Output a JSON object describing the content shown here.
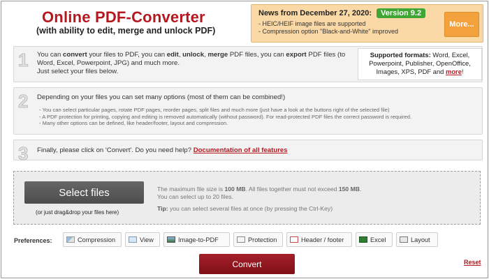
{
  "header": {
    "title": "Online PDF-Converter",
    "subtitle": "(with ability to edit, merge and unlock PDF)"
  },
  "news": {
    "title": "News from December 27, 2020:",
    "version": "Version 9.2",
    "items": [
      "HEIC/HEIF image files are supported",
      "Compression option \"Black-and-White\" improved"
    ],
    "more_label": "More..."
  },
  "step1": {
    "number": "1",
    "text_parts": {
      "a": "You can ",
      "b": "convert",
      "c": " your files to PDF, you can ",
      "d": "edit",
      "e": ", ",
      "f": "unlock",
      "g": ", ",
      "h": "merge",
      "i": " PDF files, you can ",
      "j": "export",
      "k": " PDF files (to Word, Excel, Powerpoint, JPG) and much more.",
      "l": "Just select your files below."
    },
    "formats_label": "Supported formats:",
    "formats_text": " Word, Excel, Powerpoint, Publisher, OpenOffice, Images, XPS, PDF and ",
    "formats_more": "more",
    "formats_end": "!"
  },
  "step2": {
    "number": "2",
    "text": "Depending on your files you can set many options (most of them can be combined!)",
    "items": [
      "You can select particular pages, rotate PDF pages, reorder pages, split files and much more (just have a look at the buttons right of the selected file)",
      "A PDF protection for printing, copying and editing is removed automatically (without password). For read-protected PDF files the correct password is required.",
      "Many other options can be defined, like header/footer, layout and compression."
    ]
  },
  "step3": {
    "number": "3",
    "text": "Finally, please click on 'Convert'. Do you need help? ",
    "link": "Documentation of all features"
  },
  "upload": {
    "select_label": "Select files",
    "drag_hint": "(or just drag&drop your files here)",
    "info_a": "The maximum file size is ",
    "info_size": "100 MB",
    "info_b": ". All files together must not exceed ",
    "info_total": "150 MB",
    "info_c": ".",
    "info_line2": "You can select up to 20 files.",
    "tip_label": "Tip:",
    "tip_text": " you can select several files at once (by pressing the Ctrl-Key)"
  },
  "preferences": {
    "label": "Preferences:",
    "items": [
      {
        "label": "Compression",
        "icon": "compression-icon"
      },
      {
        "label": "View",
        "icon": "view-icon"
      },
      {
        "label": "Image-to-PDF",
        "icon": "image-icon"
      },
      {
        "label": "Protection",
        "icon": "protection-icon"
      },
      {
        "label": "Header / footer",
        "icon": "header-footer-icon"
      },
      {
        "label": "Excel",
        "icon": "excel-icon"
      },
      {
        "label": "Layout",
        "icon": "layout-icon"
      }
    ]
  },
  "actions": {
    "convert_label": "Convert",
    "reset_label": "Reset"
  },
  "colors": {
    "brand_red": "#b5181f",
    "news_bg": "#fbd9a6",
    "version_green": "#3fa535",
    "more_orange": "#f3a13c"
  }
}
